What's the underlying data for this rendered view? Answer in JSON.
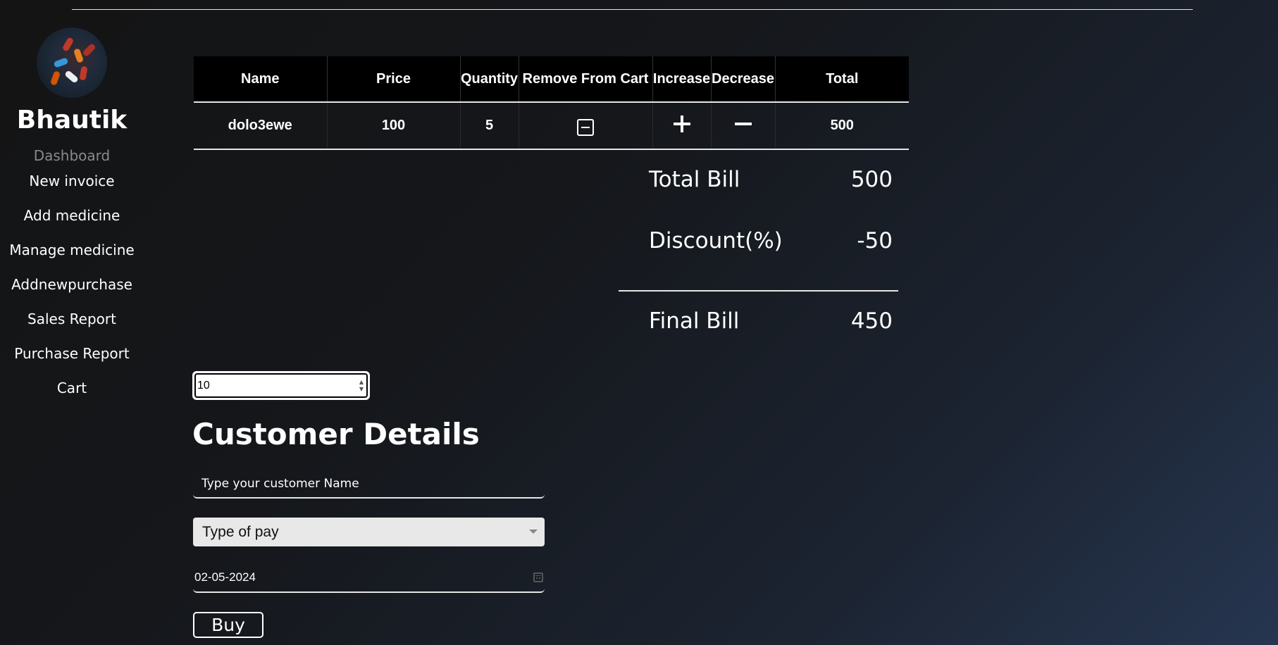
{
  "sidebar": {
    "brand": "Bhautik",
    "items": [
      {
        "label": "Dashboard"
      },
      {
        "label": "New invoice"
      },
      {
        "label": "Add medicine"
      },
      {
        "label": "Manage medicine"
      },
      {
        "label": "Addnewpurchase"
      },
      {
        "label": "Sales Report"
      },
      {
        "label": "Purchase Report"
      },
      {
        "label": "Cart"
      }
    ]
  },
  "cart_table": {
    "headers": [
      "Name",
      "Price",
      "Quantity",
      "Remove From Cart",
      "Increase",
      "Decrease",
      "Total"
    ],
    "rows": [
      {
        "name": "dolo3ewe",
        "price": "100",
        "quantity": "5",
        "total": "500"
      }
    ]
  },
  "bill": {
    "total_label": "Total Bill",
    "total_value": "500",
    "discount_label": "Discount(%)",
    "discount_value": "-50",
    "final_label": "Final Bill",
    "final_value": "450"
  },
  "discount_input": {
    "value": "10"
  },
  "customer": {
    "title": "Customer Details",
    "name_placeholder": "Type your customer Name",
    "pay_select": "Type of pay",
    "date_value": "02-05-2024",
    "buy_label": "Buy"
  },
  "icons": {
    "remove": "minus-square-icon",
    "increase": "plus-icon",
    "decrease": "minus-icon",
    "calendar": "calendar-icon"
  }
}
